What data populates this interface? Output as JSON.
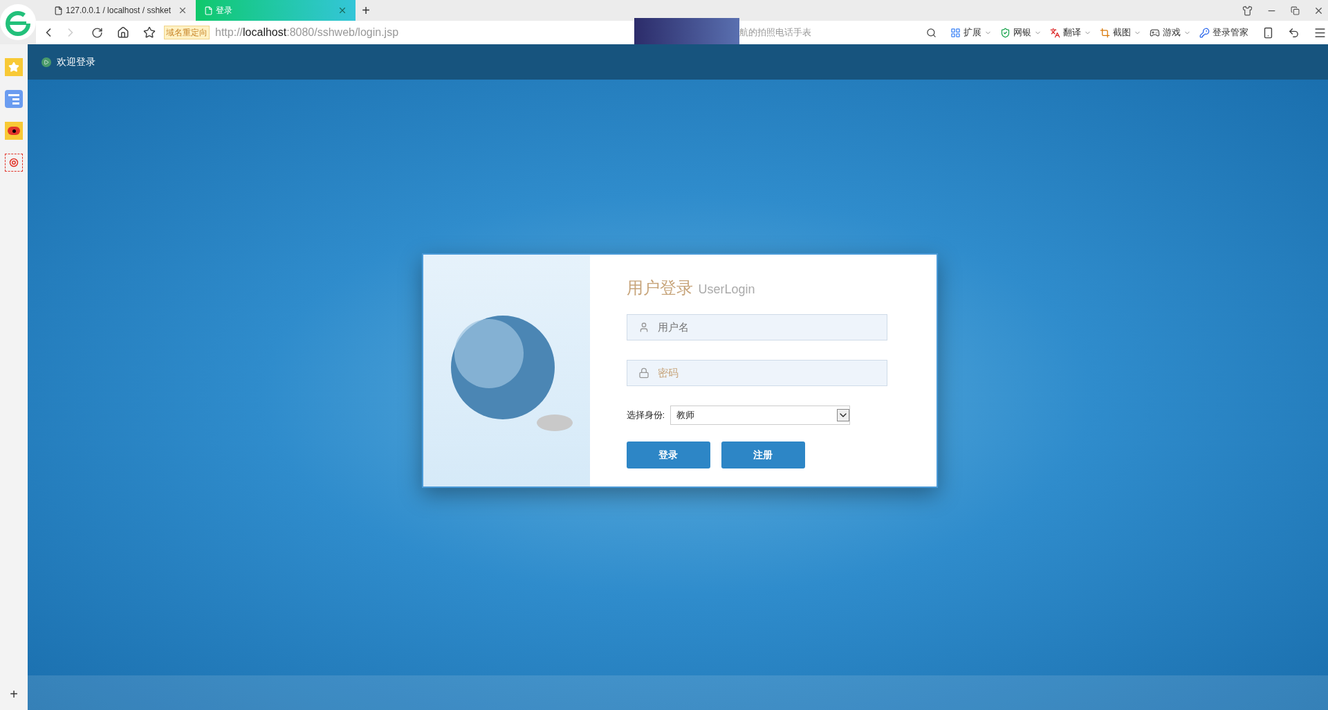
{
  "browser": {
    "tabs": [
      {
        "label": "127.0.0.1 / localhost / sshket",
        "selected": false
      },
      {
        "label": "登录",
        "selected": true
      }
    ],
    "new_tab": "+",
    "redirect_badge": "域名重定向",
    "url": {
      "prefix": "http://",
      "host": "localhost",
      "rest": ":8080/sshweb/login.jsp"
    },
    "search": {
      "placeholder": "航的拍照电话手表"
    },
    "toolbar": [
      {
        "kind": "grid",
        "label": "扩展"
      },
      {
        "kind": "shield",
        "label": "网银"
      },
      {
        "kind": "translate",
        "label": "翻译"
      },
      {
        "kind": "crop",
        "label": "截图"
      },
      {
        "kind": "game",
        "label": "游戏"
      },
      {
        "kind": "key",
        "label": "登录管家"
      }
    ],
    "sidebar_add": "+"
  },
  "page": {
    "header": "欢迎登录",
    "login": {
      "title": "用户登录",
      "subtitle": "UserLogin",
      "username": {
        "placeholder": "用户名"
      },
      "password": {
        "placeholder": "密码"
      },
      "role": {
        "label": "选择身份:",
        "value": "教师"
      },
      "buttons": [
        "登录",
        "注册"
      ]
    }
  }
}
